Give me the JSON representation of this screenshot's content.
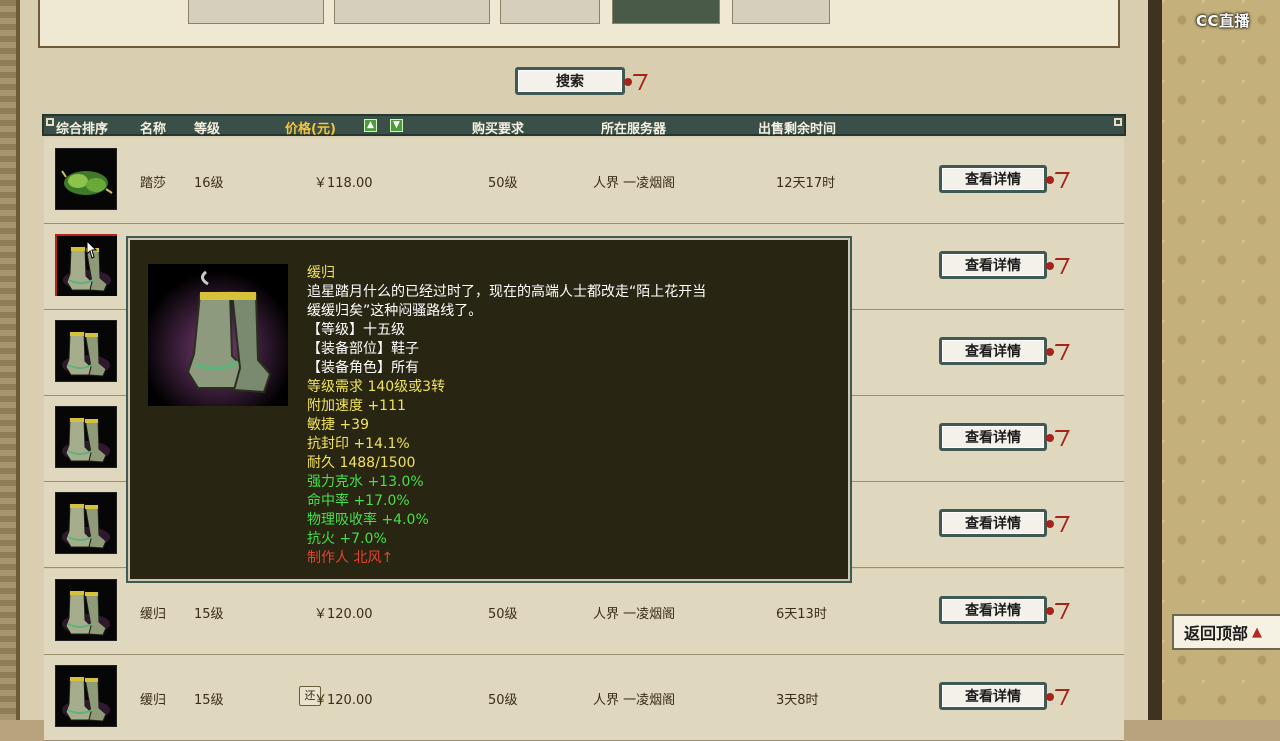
{
  "overlay": {
    "logo": "CC直播"
  },
  "search": {
    "button_label": "搜索"
  },
  "table": {
    "headers": [
      "综合排序",
      "名称",
      "等级",
      "价格(元)",
      "购买要求",
      "所在服务器",
      "出售剩余时间"
    ],
    "sort_up": "▲",
    "sort_down": "▼",
    "detail_label": "查看详情",
    "rows": [
      {
        "name": "踏莎",
        "level": "16级",
        "price": "￥118.00",
        "req": "50级",
        "server": "人界 一凌烟阁",
        "time": "12天17时",
        "refund": ""
      },
      {
        "name": "",
        "level": "",
        "price": "",
        "req": "",
        "server": "",
        "time": "",
        "refund": ""
      },
      {
        "name": "",
        "level": "",
        "price": "",
        "req": "",
        "server": "",
        "time": "",
        "refund": ""
      },
      {
        "name": "",
        "level": "",
        "price": "",
        "req": "",
        "server": "",
        "time": "",
        "refund": ""
      },
      {
        "name": "",
        "level": "",
        "price": "",
        "req": "",
        "server": "",
        "time": "",
        "refund": ""
      },
      {
        "name": "缓归",
        "level": "15级",
        "price": "￥120.00",
        "req": "50级",
        "server": "人界 一凌烟阁",
        "time": "6天13时",
        "refund": ""
      },
      {
        "name": "缓归",
        "level": "15级",
        "price": "￥120.00",
        "req": "50级",
        "server": "人界 一凌烟阁",
        "time": "3天8时",
        "refund": "还"
      }
    ]
  },
  "tooltip": {
    "lines": [
      {
        "text": "缓归",
        "color": "yellow"
      },
      {
        "text": "追星踏月什么的已经过时了，现在的高端人士都改走“陌上花开当",
        "color": "white"
      },
      {
        "text": "缓缓归矣”这种闷骚路线了。",
        "color": "white"
      },
      {
        "text": "【等级】十五级",
        "color": "white"
      },
      {
        "text": "【装备部位】鞋子",
        "color": "white"
      },
      {
        "text": "【装备角色】所有",
        "color": "white"
      },
      {
        "text": "等级需求 140级或3转",
        "color": "yellow"
      },
      {
        "text": "附加速度 +111",
        "color": "yellow"
      },
      {
        "text": "敏捷 +39",
        "color": "yellow"
      },
      {
        "text": "抗封印 +14.1%",
        "color": "yellow"
      },
      {
        "text": "耐久 1488/1500",
        "color": "yellow"
      },
      {
        "text": "强力克水 +13.0%",
        "color": "green"
      },
      {
        "text": "命中率 +17.0%",
        "color": "green"
      },
      {
        "text": "物理吸收率 +4.0%",
        "color": "green"
      },
      {
        "text": "抗火 +7.0%",
        "color": "green"
      },
      {
        "text": "制作人 北风↑",
        "color": "red"
      }
    ]
  },
  "back_to_top": {
    "label": "返回顶部",
    "arrow": "▲"
  },
  "colors": {
    "header_bg": "#394f48",
    "row_bg": "#e0d7bf",
    "tooltip_bg": "#282513",
    "accent_red": "#a5231b"
  }
}
